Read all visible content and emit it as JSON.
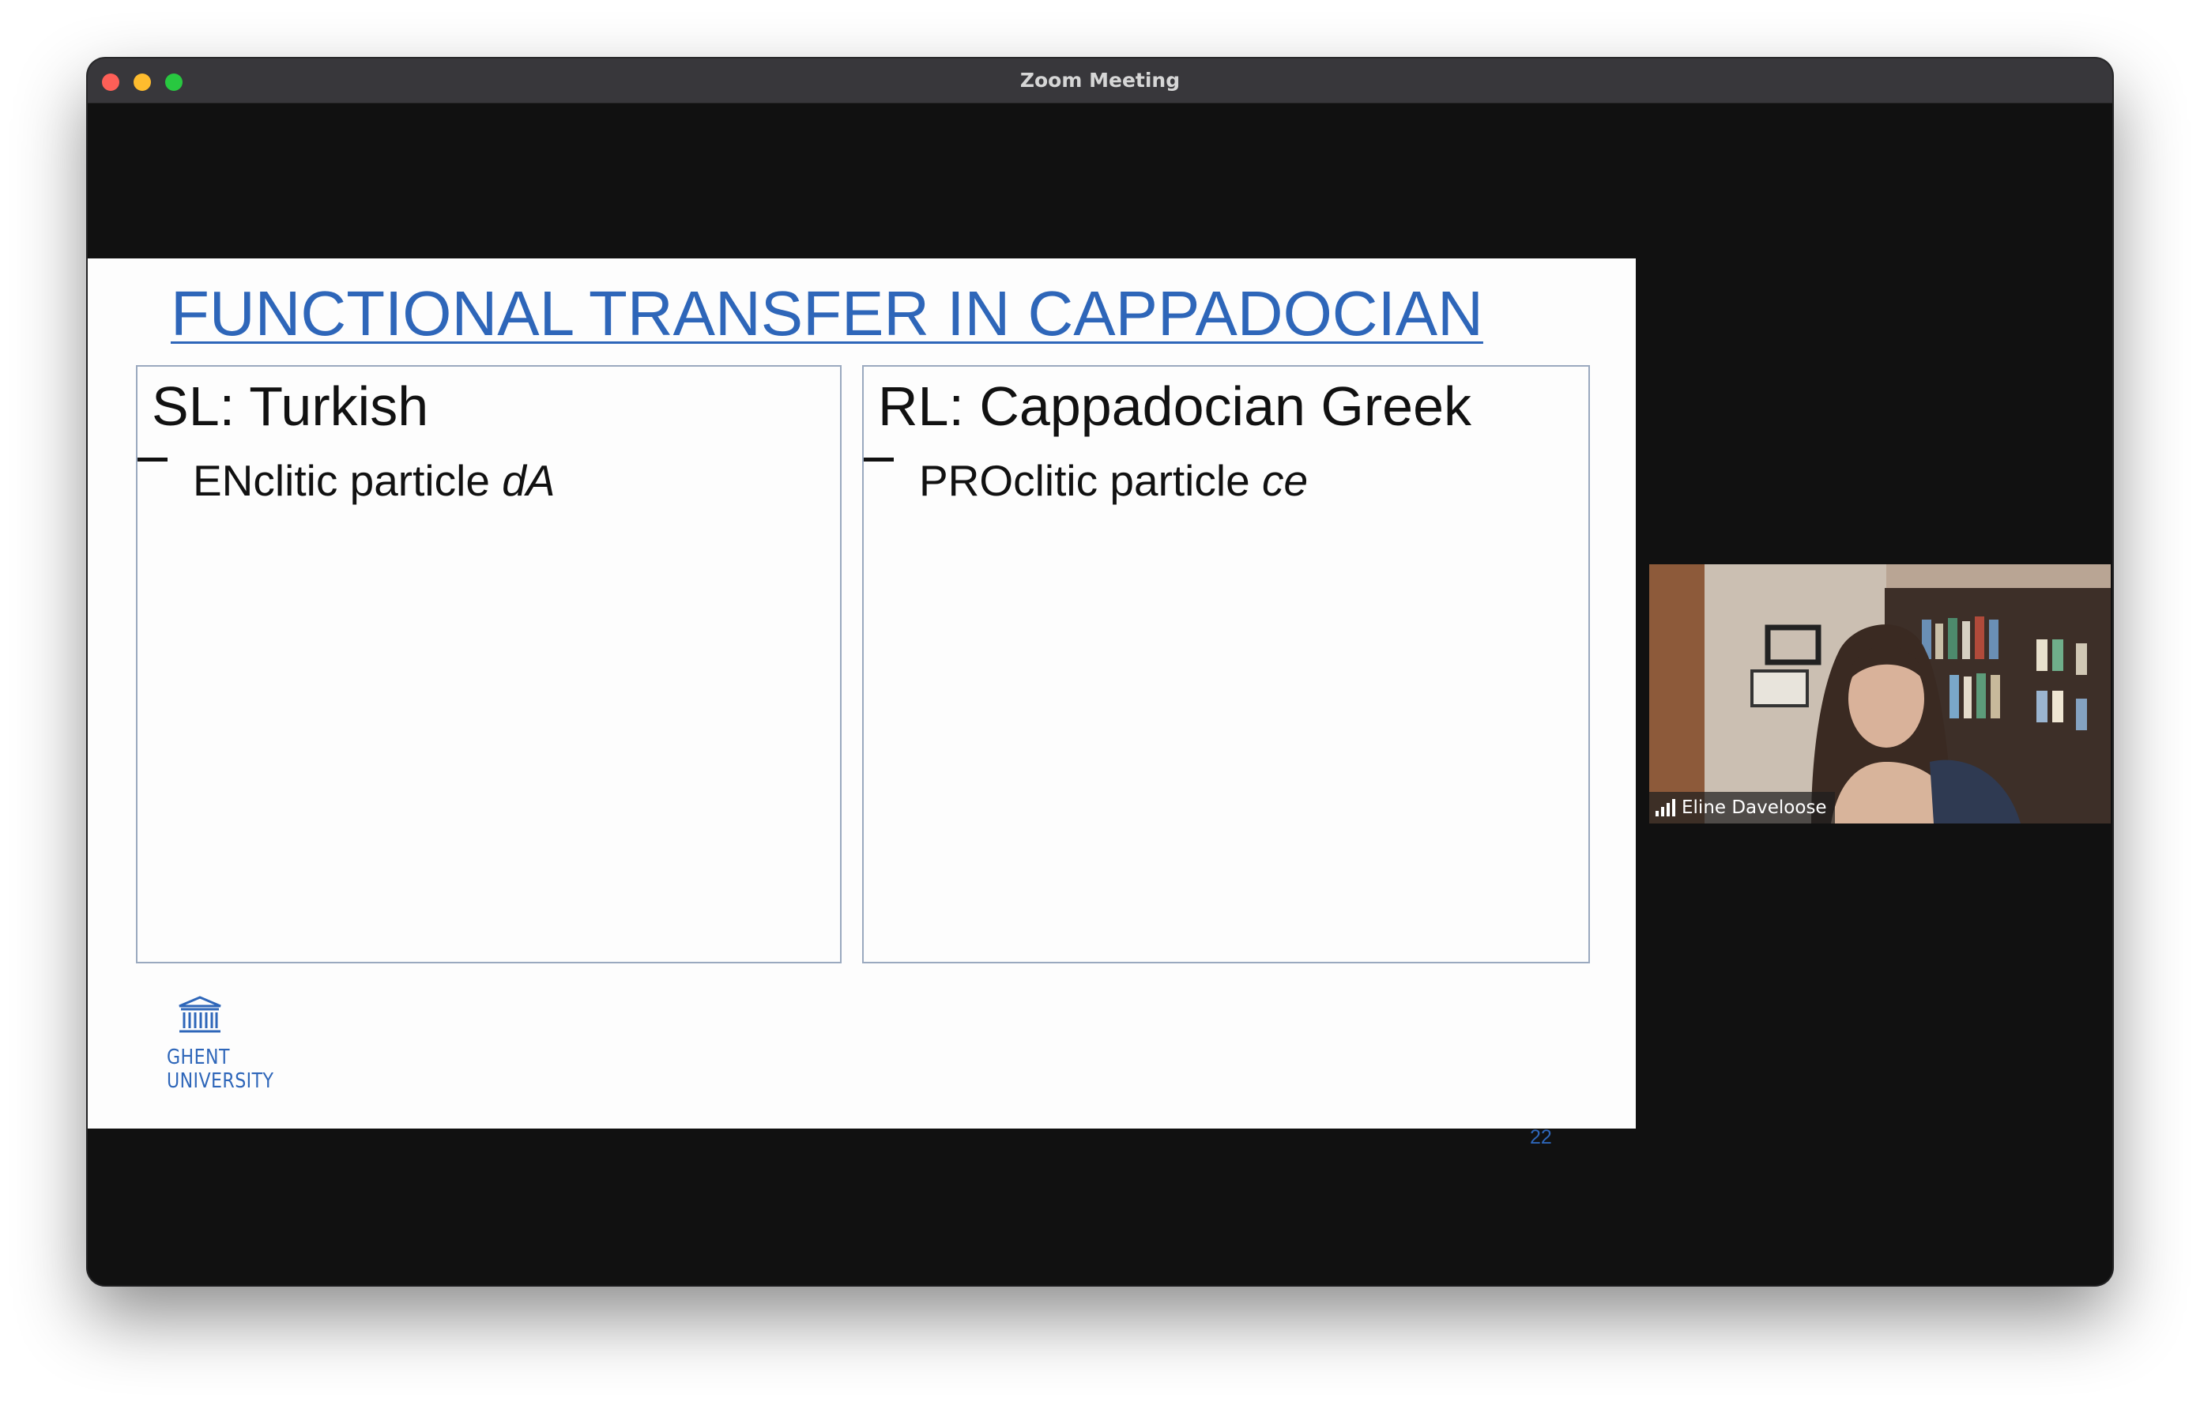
{
  "window": {
    "title": "Zoom Meeting"
  },
  "slide": {
    "title": "FUNCTIONAL TRANSFER IN CAPPADOCIAN",
    "left_panel": {
      "heading": "SL: Turkish",
      "bullet_text": "ENclitic particle ",
      "bullet_italic": "dA"
    },
    "right_panel": {
      "heading": "RL: Cappadocian Greek",
      "bullet_text": "PROclitic particle ",
      "bullet_italic": "ce"
    },
    "logo": {
      "line1": "GHENT",
      "line2": "UNIVERSITY",
      "icon": "university-building-icon"
    },
    "page_number": "22",
    "accent_color": "#2e66b9"
  },
  "participant": {
    "name": "Eline Daveloose",
    "icon": "signal-strength-icon"
  }
}
